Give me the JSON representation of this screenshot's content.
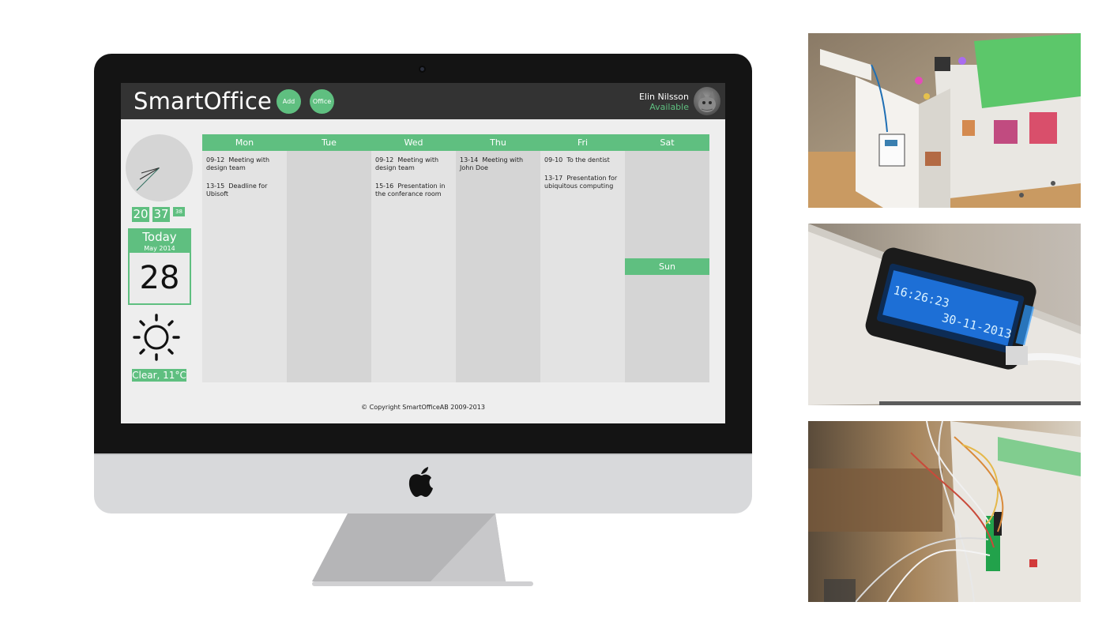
{
  "app": {
    "title": "SmartOffice",
    "buttons": {
      "add": "Add",
      "office": "Office"
    },
    "user": {
      "name": "Elin Nilsson",
      "status": "Available"
    }
  },
  "clock": {
    "hours": "20",
    "minutes": "37",
    "seconds": "38"
  },
  "today": {
    "label": "Today",
    "month_year": "May 2014",
    "day": "28"
  },
  "weather": {
    "icon": "sun-icon",
    "label": "Clear, 11°C"
  },
  "calendar": {
    "days": [
      {
        "name": "Mon",
        "events": [
          {
            "time": "09-12",
            "title": "Meeting with design team"
          },
          {
            "time": "13-15",
            "title": "Deadline for Ubisoft"
          }
        ]
      },
      {
        "name": "Tue",
        "events": []
      },
      {
        "name": "Wed",
        "events": [
          {
            "time": "09-12",
            "title": "Meeting with design team"
          },
          {
            "time": "15-16",
            "title": "Presentation in the conferance room"
          }
        ]
      },
      {
        "name": "Thu",
        "events": [
          {
            "time": "13-14",
            "title": "Meeting with John Doe"
          }
        ]
      },
      {
        "name": "Fri",
        "events": [
          {
            "time": "09-10",
            "title": "To the dentist"
          },
          {
            "time": "13-17",
            "title": "Presentation for ubiquitous computing"
          }
        ]
      },
      {
        "name": "Sat",
        "events": []
      },
      {
        "name": "Sun",
        "events": []
      }
    ]
  },
  "footer": {
    "copyright": "© Copyright SmartOfficeAB 2009-2013"
  },
  "photos": {
    "lcd_display": {
      "time": "16:26:23",
      "date": "30-11-2013"
    }
  },
  "colors": {
    "accent": "#5fbf80",
    "header": "#333333",
    "screen_bg": "#eeeeee"
  }
}
